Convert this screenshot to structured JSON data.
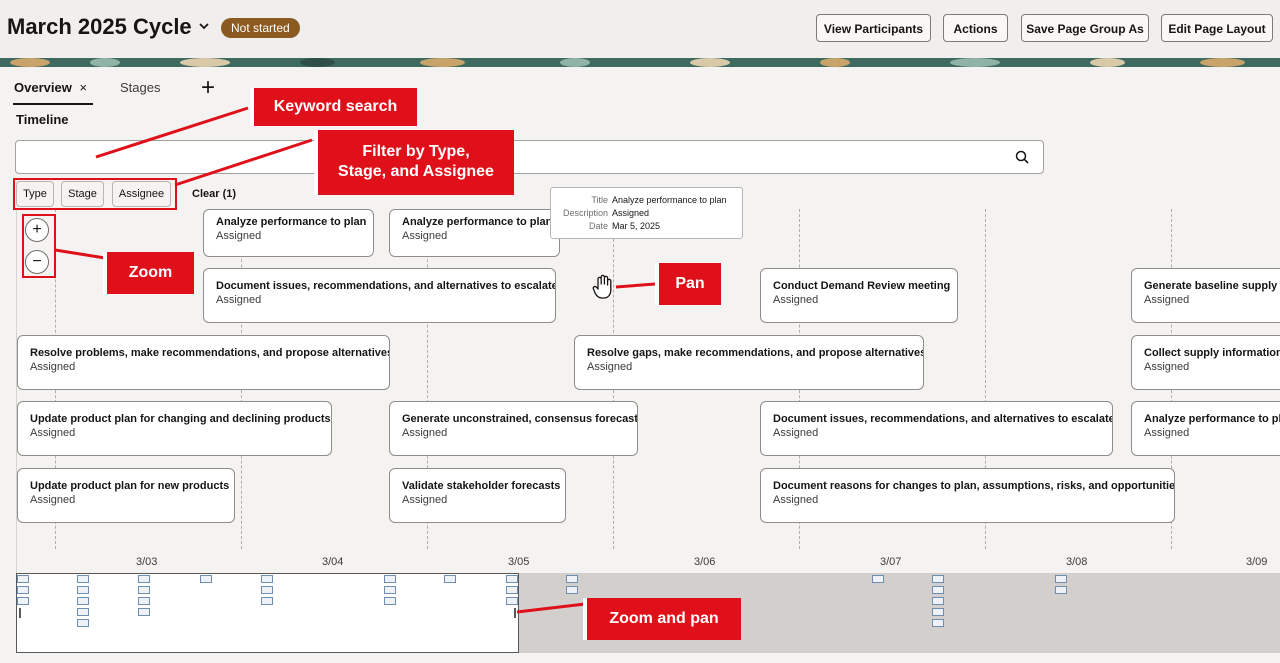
{
  "header": {
    "title": "March 2025 Cycle",
    "status": "Not started",
    "buttons": [
      "View Participants",
      "Actions",
      "Save Page Group As",
      "Edit Page Layout"
    ]
  },
  "tabs": [
    {
      "label": "Overview",
      "close": "×"
    },
    {
      "label": "Stages"
    }
  ],
  "add_tab": "+",
  "section_title": "Timeline",
  "search": {
    "placeholder": "",
    "value": ""
  },
  "filters": [
    "Type",
    "Stage",
    "Assignee"
  ],
  "clear_filters": "Clear (1)",
  "zoom": {
    "in": "+",
    "out": "−"
  },
  "tasks": [
    {
      "title": "Analyze performance to plan",
      "status": "Assigned"
    },
    {
      "title": "Analyze performance to plan",
      "status": "Assigned"
    },
    {
      "title": "Document issues, recommendations, and alternatives to escalate",
      "status": "Assigned"
    },
    {
      "title": "Conduct Demand Review meeting",
      "status": "Assigned"
    },
    {
      "title": "Generate baseline supply p",
      "status": "Assigned"
    },
    {
      "title": "Resolve problems, make recommendations, and propose alternatives",
      "status": "Assigned"
    },
    {
      "title": "Resolve gaps, make recommendations, and propose alternatives",
      "status": "Assigned"
    },
    {
      "title": "Collect supply information",
      "status": "Assigned"
    },
    {
      "title": "Update product plan for changing and declining products",
      "status": "Assigned"
    },
    {
      "title": "Generate unconstrained, consensus forecast",
      "status": "Assigned"
    },
    {
      "title": "Document issues, recommendations, and alternatives to escalate",
      "status": "Assigned"
    },
    {
      "title": "Analyze performance to pla",
      "status": "Assigned"
    },
    {
      "title": "Update product plan for new products",
      "status": "Assigned"
    },
    {
      "title": "Validate stakeholder forecasts",
      "status": "Assigned"
    },
    {
      "title": "Document reasons for changes to plan, assumptions, risks, and opportunities",
      "status": "Assigned"
    }
  ],
  "dates": [
    "3/03",
    "3/04",
    "3/05",
    "3/06",
    "3/07",
    "3/08",
    "3/09"
  ],
  "tooltip": {
    "title_label": "Title",
    "title": "Analyze performance to plan",
    "description_label": "Description",
    "description": "Assigned",
    "date_label": "Date",
    "date": "Mar 5, 2025"
  },
  "annotations": {
    "keyword_search": "Keyword search",
    "filter_line1": "Filter by Type,",
    "filter_line2": "Stage, and Assignee",
    "zoom": "Zoom",
    "pan": "Pan",
    "zoom_pan": "Zoom and pan"
  },
  "colors": {
    "status_badge": "#8a5a21",
    "annotation": "#e0101a",
    "banner": "#3f6a5f"
  }
}
